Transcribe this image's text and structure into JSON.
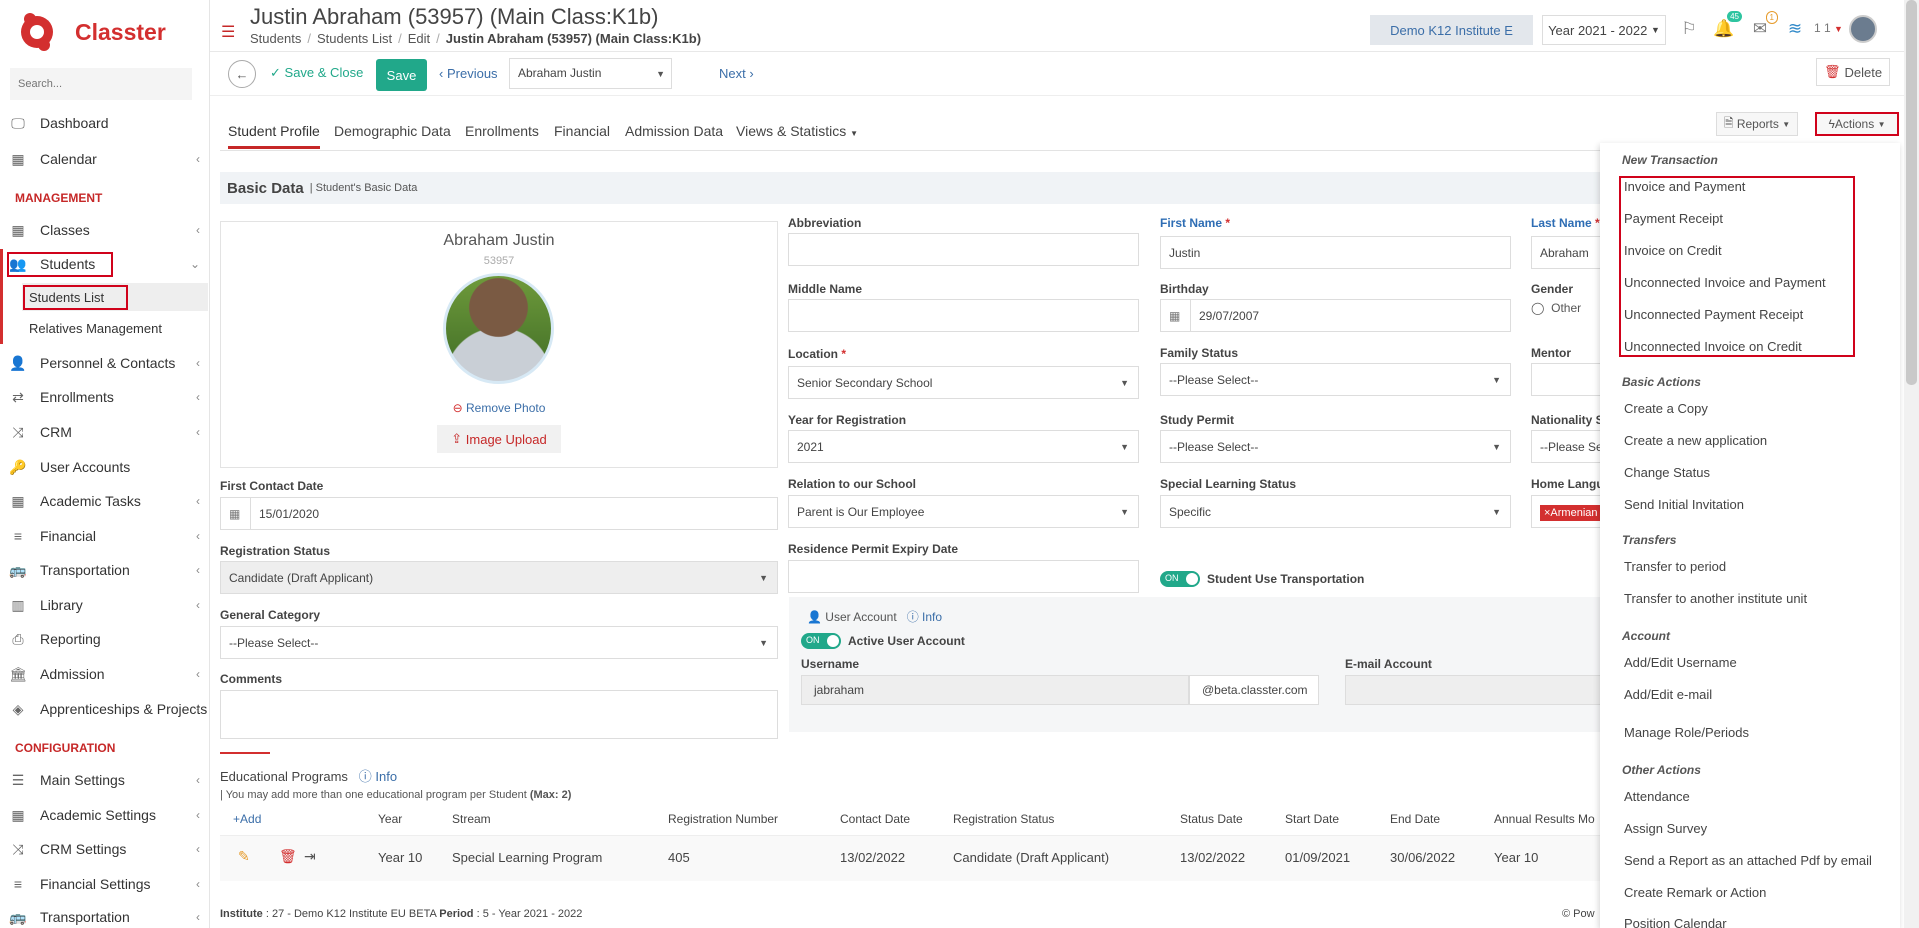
{
  "app": {
    "brand": "Classter",
    "search_placeholder": "Search..."
  },
  "sidebar": {
    "items": [
      {
        "label": "Dashboard",
        "icon": "monitor-icon"
      },
      {
        "label": "Calendar",
        "icon": "calendar-icon"
      },
      {
        "label": "Classes",
        "icon": "grid-icon"
      },
      {
        "label": "Students",
        "icon": "users-icon"
      },
      {
        "label": "Personnel & Contacts",
        "icon": "person-icon"
      },
      {
        "label": "Enrollments",
        "icon": "exchange-icon"
      },
      {
        "label": "CRM",
        "icon": "shuffle-icon"
      },
      {
        "label": "User Accounts",
        "icon": "key-icon"
      },
      {
        "label": "Academic Tasks",
        "icon": "tasks-icon"
      },
      {
        "label": "Financial",
        "icon": "coins-icon"
      },
      {
        "label": "Transportation",
        "icon": "bus-icon"
      },
      {
        "label": "Library",
        "icon": "library-icon"
      },
      {
        "label": "Reporting",
        "icon": "print-icon"
      },
      {
        "label": "Admission",
        "icon": "bank-icon"
      },
      {
        "label": "Apprenticeships & Projects",
        "icon": "cube-icon"
      },
      {
        "label": "Main Settings",
        "icon": "sliders-icon"
      },
      {
        "label": "Academic Settings",
        "icon": "grid-icon"
      },
      {
        "label": "CRM Settings",
        "icon": "shuffle-icon"
      },
      {
        "label": "Financial Settings",
        "icon": "coins-icon"
      },
      {
        "label": "Transportation",
        "icon": "bus-icon"
      }
    ],
    "sections": {
      "management": "MANAGEMENT",
      "configuration": "CONFIGURATION"
    },
    "sub_items": [
      "Students List",
      "Relatives Management"
    ]
  },
  "header": {
    "title": "Justin Abraham (53957) (Main Class:K1b)",
    "breadcrumb": [
      "Students",
      "Students List",
      "Edit",
      "Justin Abraham (53957) (Main Class:K1b)"
    ],
    "institute": "Demo K12 Institute E",
    "year": "Year 2021 - 2022",
    "badge_notifications": "45",
    "badge_messages": "1",
    "user_short": "1 1"
  },
  "toolbar": {
    "save_close": "Save & Close",
    "save": "Save",
    "previous": "Previous",
    "student_select": "Abraham Justin",
    "next": "Next",
    "delete": "Delete"
  },
  "tabs": [
    "Student Profile",
    "Demographic Data",
    "Enrollments",
    "Financial",
    "Admission Data",
    "Views & Statistics"
  ],
  "reports_label": "Reports",
  "actions_label": "Actions",
  "basic_data": {
    "title": "Basic Data",
    "subtitle": "| Student's Basic Data"
  },
  "profile": {
    "name": "Abraham Justin",
    "id": "53957",
    "remove_photo": "Remove Photo",
    "image_upload": "Image Upload"
  },
  "form": {
    "abbreviation": {
      "label": "Abbreviation",
      "value": ""
    },
    "first_name": {
      "label": "First Name",
      "value": "Justin"
    },
    "last_name": {
      "label": "Last Name",
      "value": "Abraham"
    },
    "middle_name": {
      "label": "Middle Name",
      "value": ""
    },
    "birthday": {
      "label": "Birthday",
      "value": "29/07/2007"
    },
    "gender": {
      "label": "Gender",
      "value": "Other"
    },
    "location": {
      "label": "Location",
      "value": "Senior Secondary School"
    },
    "family_status": {
      "label": "Family Status",
      "value": "--Please Select--"
    },
    "mentor": {
      "label": "Mentor"
    },
    "year_registration": {
      "label": "Year for Registration",
      "value": "2021"
    },
    "study_permit": {
      "label": "Study Permit",
      "value": "--Please Select--"
    },
    "nationality": {
      "label": "Nationality S",
      "value": "--Please Se"
    },
    "first_contact": {
      "label": "First Contact Date",
      "value": "15/01/2020"
    },
    "relation": {
      "label": "Relation to our School",
      "value": "Parent is Our Employee"
    },
    "special_learning": {
      "label": "Special Learning Status",
      "value": "Specific"
    },
    "home_language": {
      "label": "Home Langu",
      "value": "×Armenian"
    },
    "registration_status": {
      "label": "Registration Status",
      "value": "Candidate (Draft Applicant)"
    },
    "residence_permit": {
      "label": "Residence Permit Expiry Date",
      "value": ""
    },
    "transport_toggle": {
      "state": "ON",
      "label": "Student Use Transportation"
    },
    "general_category": {
      "label": "General Category",
      "value": "--Please Select--"
    },
    "comments": {
      "label": "Comments",
      "value": ""
    },
    "user_account": {
      "label": "User Account",
      "info": "Info"
    },
    "active_toggle": {
      "state": "ON",
      "label": "Active User Account"
    },
    "username": {
      "label": "Username",
      "value": "jabraham",
      "domain": "@beta.classter.com"
    },
    "email_account": {
      "label": "E-mail Account",
      "value": ""
    }
  },
  "edu_programs": {
    "title": "Educational Programs",
    "info": "Info",
    "note": "| You may add more than one educational program per Student",
    "note_bold": "(Max: 2)",
    "add": "Add",
    "columns": [
      "Year",
      "Stream",
      "Registration Number",
      "Contact Date",
      "Registration Status",
      "Status Date",
      "Start Date",
      "End Date",
      "Annual Results Mo"
    ],
    "row": [
      "Year 10",
      "Special Learning Program",
      "405",
      "13/02/2022",
      "Candidate (Draft Applicant)",
      "13/02/2022",
      "01/09/2021",
      "30/06/2022",
      "Year 10"
    ]
  },
  "footer": {
    "institute_label": "Institute",
    "institute_value": ": 27 - Demo K12 Institute EU BETA",
    "period_label": "Period",
    "period_value": ": 5 - Year 2021 - 2022",
    "right": "Pow"
  },
  "actions_menu": {
    "new_transaction": "New Transaction",
    "new_items": [
      "Invoice and Payment",
      "Payment Receipt",
      "Invoice on Credit",
      "Unconnected Invoice and Payment",
      "Unconnected Payment Receipt",
      "Unconnected Invoice on Credit"
    ],
    "basic_actions": "Basic Actions",
    "basic_items": [
      "Create a Copy",
      "Create a new application",
      "Change Status",
      "Send Initial Invitation"
    ],
    "transfers": "Transfers",
    "transfer_items": [
      "Transfer to period",
      "Transfer to another institute unit"
    ],
    "account": "Account",
    "account_items": [
      "Add/Edit Username",
      "Add/Edit e-mail",
      "Manage Role/Periods"
    ],
    "other_actions": "Other Actions",
    "other_items": [
      "Attendance",
      "Assign Survey",
      "Send a Report as an attached Pdf by email",
      "Create Remark or Action",
      "Position Calendar"
    ]
  },
  "colors": {
    "brand_red": "#c62828",
    "accent_green": "#21a88a",
    "link_blue": "#3b6ea8",
    "highlight_red": "#d0021b"
  }
}
